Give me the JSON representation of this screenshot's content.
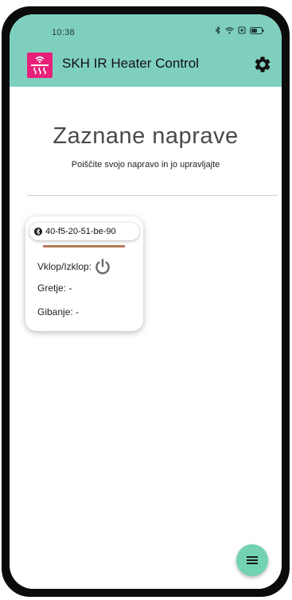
{
  "status_bar": {
    "time": "10:38",
    "icons": [
      "bluetooth-icon",
      "wifi-icon",
      "battery-saver-icon",
      "battery-icon"
    ]
  },
  "app_bar": {
    "title": "SKH IR Heater Control",
    "logo_icon": "heater-wifi-icon",
    "settings_icon": "gear-icon",
    "background": "#7fcfbf"
  },
  "main": {
    "title": "Zaznane naprave",
    "subtitle": "Poiščite svojo napravo in jo upravljajte"
  },
  "devices": [
    {
      "id": "40-f5-20-51-be-90",
      "connection_icon": "bluetooth-icon",
      "accent_color": "#b27a55",
      "power_label": "Vklop/Izklop:",
      "power_icon": "power-icon",
      "heating_label": "Gretje: -",
      "motion_label": "Gibanje: -"
    }
  ],
  "fab": {
    "icon": "menu-icon",
    "color": "#73d3b1"
  }
}
